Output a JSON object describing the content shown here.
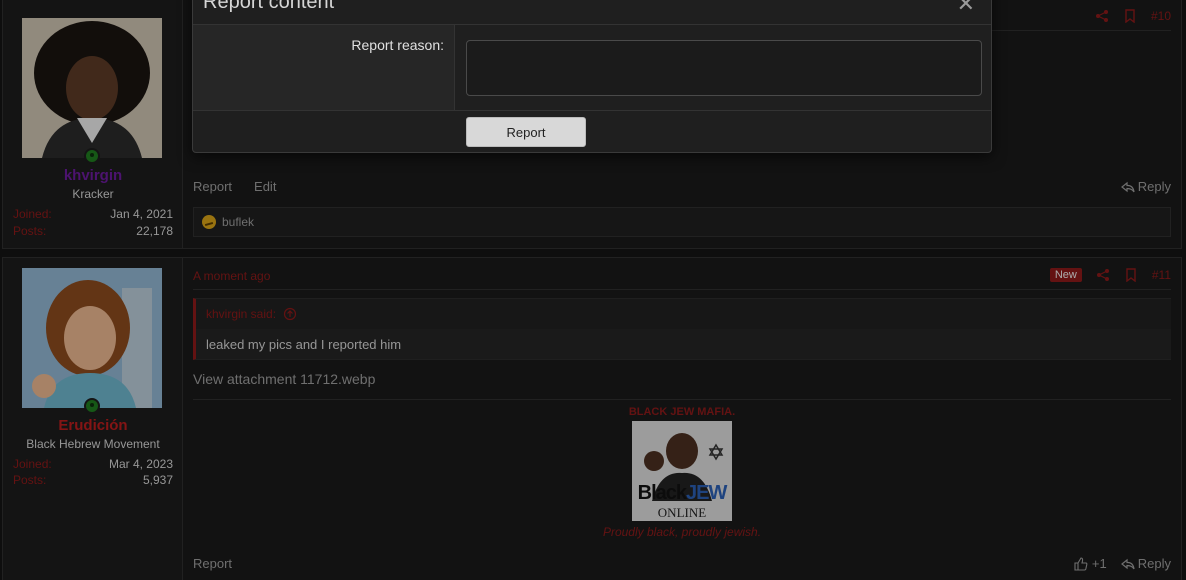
{
  "modal": {
    "title": "Report content",
    "close_glyph": "✕",
    "reason_label": "Report reason:",
    "reason_value": "",
    "submit_label": "Report"
  },
  "posts": [
    {
      "number": "#10",
      "user": {
        "name": "khvirgin",
        "title": "Kracker",
        "joined_label": "Joined:",
        "joined": "Jan 4, 2021",
        "posts_label": "Posts:",
        "posts": "22,178",
        "name_color": "#6a1b9a"
      },
      "actions": {
        "report": "Report",
        "edit": "Edit",
        "reply": "Reply"
      },
      "reaction": {
        "user": "buflek",
        "icon": "confused-emoji-icon"
      }
    },
    {
      "time": "A moment ago",
      "badge": "New",
      "number": "#11",
      "user": {
        "name": "Erudición",
        "title": "Black Hebrew Movement",
        "joined_label": "Joined:",
        "joined": "Mar 4, 2023",
        "posts_label": "Posts:",
        "posts": "5,937",
        "name_color": "#b71c1c"
      },
      "quote": {
        "author": "khvirgin said:",
        "text": "leaked my pics and I reported him"
      },
      "attachment_link": "View attachment 11712.webp",
      "signature": {
        "title": "BLACK JEW MAFIA.",
        "image_text_1": "Black",
        "image_text_2": "JEW",
        "image_text_3": "ONLINE",
        "slogan": "Proudly black, proudly jewish."
      },
      "actions": {
        "report": "Report",
        "like_count": "+1",
        "reply": "Reply"
      }
    }
  ],
  "colors": {
    "accent": "#8b1a1a",
    "background": "#141414",
    "panel": "#1a1a1a"
  }
}
